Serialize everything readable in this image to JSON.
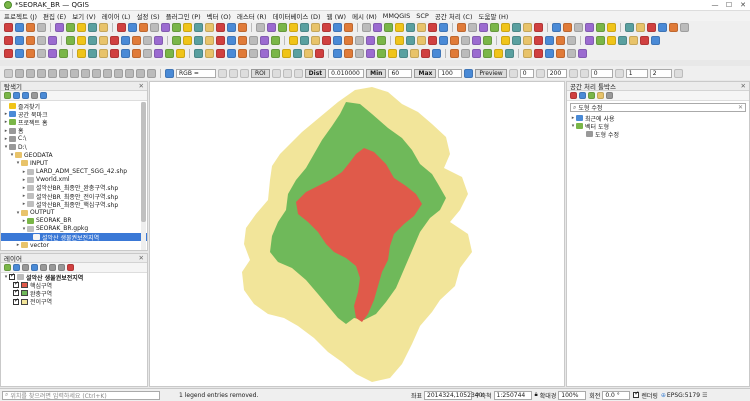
{
  "window": {
    "title": "*SEORAK_BR — QGIS"
  },
  "menu": [
    "프로젝트 (J)",
    "편집 (E)",
    "보기 (V)",
    "레이어 (L)",
    "설정 (S)",
    "플러그인 (P)",
    "벡터 (O)",
    "래스터 (R)",
    "데이터베이스 (D)",
    "웹 (W)",
    "메시 (M)",
    "MMQGIS",
    "SCP",
    "공간 처리 (C)",
    "도움말 (H)"
  ],
  "scp_toolbar": {
    "rgb_label": "RGB =",
    "roi_label": "ROI",
    "dist_label": "Dist",
    "dist_value": "0.010000",
    "min_label": "Min",
    "min_value": "60",
    "max_label": "Max",
    "max_value": "100",
    "preview_label": "Preview",
    "val1": "0",
    "val2": "200",
    "val3": "0",
    "val4": "1",
    "val5": "2"
  },
  "browser": {
    "title": "탐색기",
    "items": [
      {
        "label": "즐겨찾기",
        "indent": 0,
        "arrow": "",
        "icon": "#f0c419"
      },
      {
        "label": "공간 북마크",
        "indent": 0,
        "arrow": "▸",
        "icon": "#4a8ad6"
      },
      {
        "label": "프로젝트 홈",
        "indent": 0,
        "arrow": "▸",
        "icon": "#7ab648"
      },
      {
        "label": "홈",
        "indent": 0,
        "arrow": "▸",
        "icon": "#999"
      },
      {
        "label": "C:\\",
        "indent": 0,
        "arrow": "▸",
        "icon": "#999"
      },
      {
        "label": "D:\\",
        "indent": 0,
        "arrow": "▾",
        "icon": "#999"
      },
      {
        "label": "GEODATA",
        "indent": 1,
        "arrow": "▾",
        "icon": "#e8c36a"
      },
      {
        "label": "INPUT",
        "indent": 2,
        "arrow": "▾",
        "icon": "#e8c36a"
      },
      {
        "label": "LARD_ADM_SECT_SGG_42.shp",
        "indent": 3,
        "arrow": "▸",
        "icon": "#bfbfbf"
      },
      {
        "label": "Vworld.xml",
        "indent": 3,
        "arrow": "▸",
        "icon": "#bfbfbf"
      },
      {
        "label": "설악산BR_최종안_완충구역.shp",
        "indent": 3,
        "arrow": "▸",
        "icon": "#bfbfbf"
      },
      {
        "label": "설악산BR_최종안_전이구역.shp",
        "indent": 3,
        "arrow": "▸",
        "icon": "#bfbfbf"
      },
      {
        "label": "설악산BR_최종안_핵심구역.shp",
        "indent": 3,
        "arrow": "▸",
        "icon": "#bfbfbf"
      },
      {
        "label": "OUTPUT",
        "indent": 2,
        "arrow": "▾",
        "icon": "#e8c36a"
      },
      {
        "label": "SEORAK_BR",
        "indent": 3,
        "arrow": "▸",
        "icon": "#7ab648"
      },
      {
        "label": "SEORAK_BR.gpkg",
        "indent": 3,
        "arrow": "▾",
        "icon": "#bfbfbf"
      },
      {
        "label": "설악산 생물권보전지역",
        "indent": 4,
        "arrow": "",
        "icon": "#f5f5f5",
        "selected": true
      },
      {
        "label": "vector",
        "indent": 2,
        "arrow": "▸",
        "icon": "#e8c36a"
      }
    ]
  },
  "layers": {
    "title": "레이어",
    "group": "설악산 생물권보전지역",
    "items": [
      {
        "label": "핵심구역",
        "color": "#e05a4a"
      },
      {
        "label": "완충구역",
        "color": "#6fb95a"
      },
      {
        "label": "전이구역",
        "color": "#f2e59a"
      }
    ]
  },
  "processing": {
    "title": "공간 처리 툴박스",
    "search_value": "도형 수정",
    "items": [
      {
        "label": "최근에 사용",
        "indent": 0,
        "arrow": "▸"
      },
      {
        "label": "벡터 도형",
        "indent": 0,
        "arrow": "▾"
      },
      {
        "label": "도형 수정",
        "indent": 1,
        "arrow": ""
      }
    ]
  },
  "map_colors": {
    "core": "#e05a4a",
    "buffer": "#6fb95a",
    "transition": "#f2e59a",
    "background": "#ffffff"
  },
  "status": {
    "locator_placeholder": "위치를 찾으려면 입력하세요 (Ctrl+K)",
    "message": "1 legend entries removed.",
    "coord_label": "좌표",
    "coord_value": "2014324,1052340",
    "scale_label": "축척",
    "scale_value": "1:250744",
    "mag_label": "확대경",
    "mag_value": "100%",
    "rot_label": "회전",
    "rot_value": "0.0 °",
    "render_label": "렌더링",
    "crs_label": "EPSG:5179"
  }
}
